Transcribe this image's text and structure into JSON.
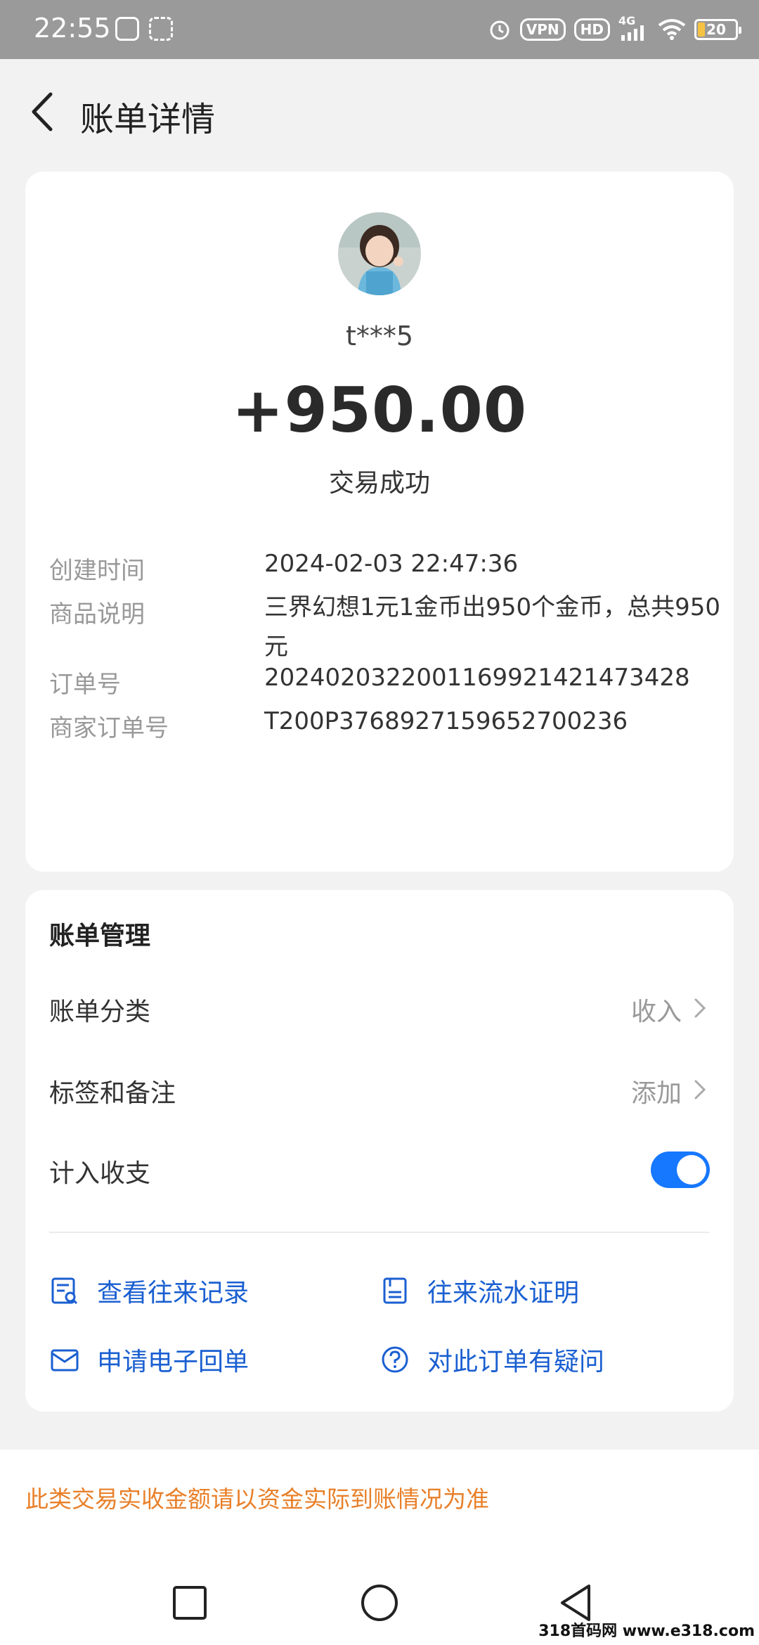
{
  "status_bar": {
    "time": "22:55",
    "vpn": "VPN",
    "hd": "HD",
    "network": "4G",
    "battery": "20"
  },
  "header": {
    "title": "账单详情"
  },
  "transaction": {
    "user_name": "t***5",
    "amount": "+950.00",
    "status": "交易成功",
    "details": [
      {
        "label": "创建时间",
        "value": "2024-02-03 22:47:36"
      },
      {
        "label": "商品说明",
        "value": "三界幻想1元1金币出950个金币，总共950元"
      },
      {
        "label": "订单号",
        "value": "2024020322001169921421473428"
      },
      {
        "label": "商家订单号",
        "value": "T200P3768927159652700236"
      }
    ]
  },
  "management": {
    "title": "账单管理",
    "category": {
      "label": "账单分类",
      "value": "收入"
    },
    "tags": {
      "label": "标签和备注",
      "value": "添加"
    },
    "include": {
      "label": "计入收支",
      "enabled": true
    },
    "actions": [
      {
        "label": "查看往来记录",
        "icon": "record-search-icon"
      },
      {
        "label": "往来流水证明",
        "icon": "certificate-icon"
      },
      {
        "label": "申请电子回单",
        "icon": "mail-icon"
      },
      {
        "label": "对此订单有疑问",
        "icon": "question-icon"
      }
    ]
  },
  "notice": "此类交易实收金额请以资金实际到账情况为准",
  "watermark": "318首码网 www.e318.com",
  "colors": {
    "accent": "#1677ff",
    "link": "#1a5fd1",
    "notice": "#e8802a"
  }
}
